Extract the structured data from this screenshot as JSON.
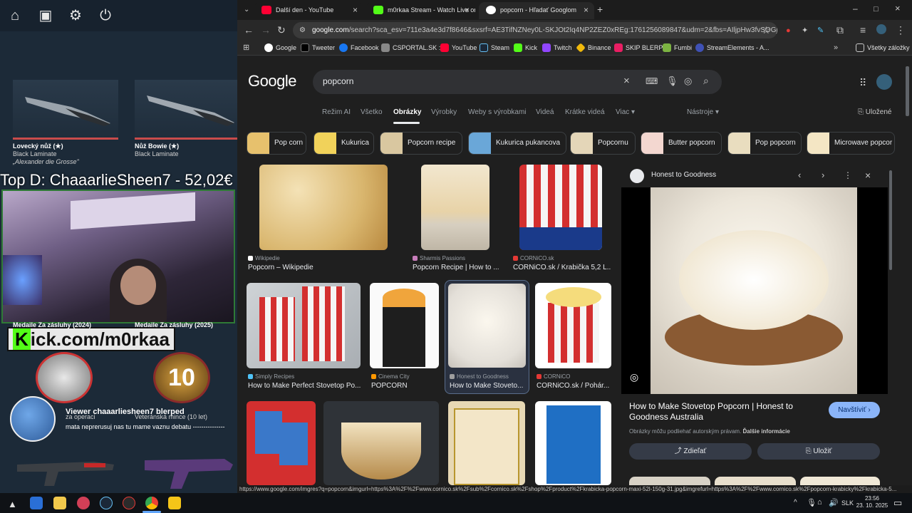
{
  "stream_overlay": {
    "topbar_icons": [
      "home-icon",
      "briefcase-icon",
      "gear-icon",
      "power-icon"
    ],
    "knives": [
      {
        "name": "Lovecký nůž (★)",
        "skin": "Black Laminate",
        "sticker": "„Alexander die Grosse\""
      },
      {
        "name": "Nůž Bowie (★)",
        "skin": "Black Laminate"
      }
    ],
    "donation_text": "Top D: ChaaarlieSheen7 - 52,02€",
    "kick_text": "ick.com/m0rkaa",
    "kick_k": "K",
    "medal_labels": [
      "Medaile Za zásluhy (2024)",
      "Medaile Za zásluhy (2025)"
    ],
    "viewer_alert": "Viewer chaaarliesheen7 blerped",
    "chat_message": "mata neprerusuj nas tu mame vaznu debatu ---------------",
    "partial_labels": [
      "za operaci",
      "Veteránská mince (10 let)"
    ]
  },
  "browser": {
    "tabs": [
      {
        "title": "Další den - YouTube",
        "color": "#ff0033"
      },
      {
        "title": "m0rkaa Stream - Watch Live on",
        "color": "#53fc18"
      },
      {
        "title": "popcorn - Hľadať Googlom",
        "color": "#ffffff"
      }
    ],
    "url_host": "google.com",
    "url_rest": "/search?sca_esv=711e3a4e3d7f8646&sxsrf=AE3TifNZNey0L-SKJOt2Iq4NP2ZEZ0xREg:1761256089847&udm=2&fbs=AIljpHw3fvSOGjSLkb...",
    "bookmarks": [
      {
        "label": "Google",
        "color": "#ffffff"
      },
      {
        "label": "Tweeter",
        "color": "#000000"
      },
      {
        "label": "Facebook",
        "color": "#1877f2"
      },
      {
        "label": "CSPORTAL.SK :)",
        "color": "#888888"
      },
      {
        "label": "YouTube",
        "color": "#ff0033"
      },
      {
        "label": "Steam",
        "color": "#1b2838"
      },
      {
        "label": "Kick",
        "color": "#53fc18"
      },
      {
        "label": "Twitch",
        "color": "#9146ff"
      },
      {
        "label": "Binance",
        "color": "#f0b90b"
      },
      {
        "label": "SKIP BLERP",
        "color": "#e91e63"
      },
      {
        "label": "Fumbi",
        "color": "#7cb342"
      },
      {
        "label": "StreamElements - A...",
        "color": "#3f51b5"
      }
    ],
    "all_bookmarks": "Všetky záložky",
    "status_url": "https://www.google.com/imgres?q=popcorn&imgurl=https%3A%2F%2Fwww.cornico.sk%2Fsub%2Fcornico.sk%2Fshop%2Fproduct%2Fkrabicka-popcorn-maxi-52l-150g-31.jpg&imgrefurl=https%3A%2F%2Fwww.cornico.sk%2Fpopcorn-krabicky%2Fkrabicka-5..."
  },
  "google": {
    "logo": "Google",
    "query": "popcorn",
    "nav_tabs": [
      "Režim AI",
      "Všetko",
      "Obrázky",
      "Výrobky",
      "Weby s výrobkami",
      "Videá",
      "Krátke videá",
      "Viac ▾"
    ],
    "active_tab": "Obrázky",
    "tools": "Nástroje ▾",
    "saved": "Uložené",
    "chips": [
      "Pop corn",
      "Kukurica",
      "Popcorn recipe",
      "Kukurica pukancova",
      "Popcornu",
      "Butter popcorn",
      "Pop popcorn",
      "Microwave popcor"
    ],
    "results": [
      {
        "source": "Wikipedie",
        "title": "Popcorn – Wikipedie",
        "src_color": "#ffffff"
      },
      {
        "source": "Sharmis Passions",
        "title": "Popcorn Recipe | How to ...",
        "src_color": "#c77dba"
      },
      {
        "source": "CORNiCO.sk",
        "title": "CORNiCO.sk / Krabička 5,2 L...",
        "src_color": "#e53935"
      },
      {
        "source": "Simply Recipes",
        "title": "How to Make Perfect Stovetop Po...",
        "src_color": "#4fc3f7"
      },
      {
        "source": "Cinema City",
        "title": "POPCORN",
        "src_color": "#ff9800"
      },
      {
        "source": "Honest to Goodness",
        "title": "How to Make Stoveto...",
        "src_color": "#9e9e9e"
      },
      {
        "source": "CORNiCO",
        "title": "CORNiCO.sk / Pohár...",
        "src_color": "#e53935"
      }
    ],
    "preview": {
      "source": "Honest to Goodness",
      "title": "How to Make Stovetop Popcorn | Honest to Goodness Australia",
      "visit": "Navštíviť ›",
      "note": "Obrázky môžu podliehať autorským právam.",
      "note_link": "Ďalšie informácie",
      "share": "Zdieľať",
      "save": "Uložiť"
    }
  },
  "taskbar": {
    "lang": "SLK",
    "time": "23:56",
    "date": "23. 10. 2025"
  }
}
